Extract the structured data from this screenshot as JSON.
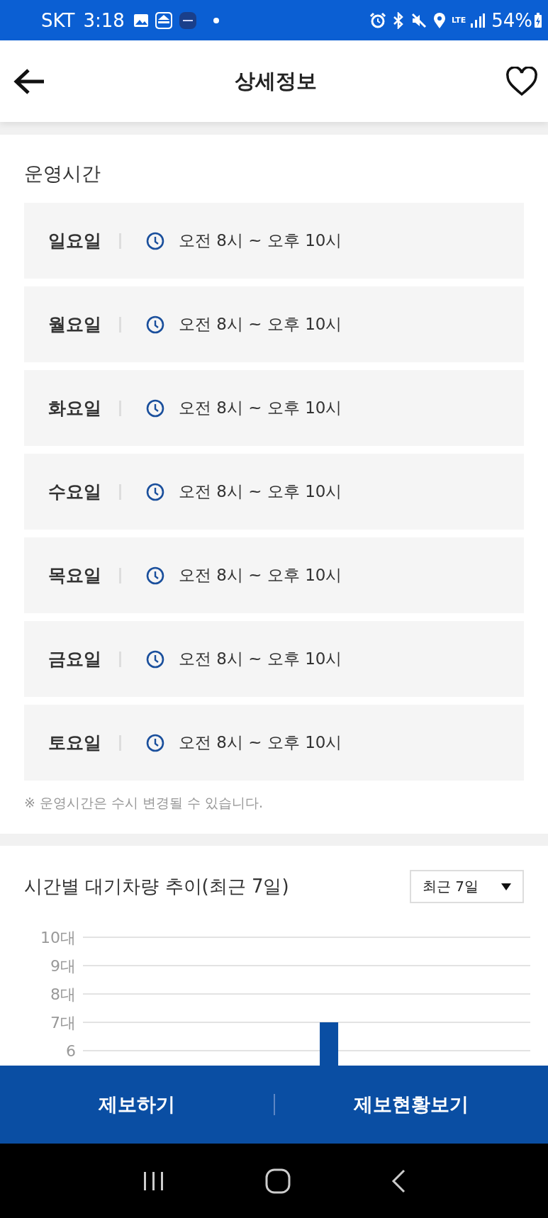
{
  "status_bar": {
    "carrier": "SKT",
    "time": "3:18",
    "network": "LTE",
    "battery": "54%"
  },
  "header": {
    "title": "상세정보",
    "favorite": false
  },
  "hours": {
    "title": "운영시간",
    "days": [
      {
        "day": "일요일",
        "time": "오전 8시 ~ 오후 10시"
      },
      {
        "day": "월요일",
        "time": "오전 8시 ~ 오후 10시"
      },
      {
        "day": "화요일",
        "time": "오전 8시 ~ 오후 10시"
      },
      {
        "day": "수요일",
        "time": "오전 8시 ~ 오후 10시"
      },
      {
        "day": "목요일",
        "time": "오전 8시 ~ 오후 10시"
      },
      {
        "day": "금요일",
        "time": "오전 8시 ~ 오후 10시"
      },
      {
        "day": "토요일",
        "time": "오전 8시 ~ 오후 10시"
      }
    ],
    "note": "※ 운영시간은 수시 변경될 수 있습니다."
  },
  "wait_chart": {
    "title": "시간별 대기차량 추이(최근 7일)",
    "period_select": {
      "value": "최근 7일"
    },
    "chart_data": {
      "type": "bar",
      "ylim": [
        0,
        10
      ],
      "grid": true,
      "yticks": [
        {
          "value": 6,
          "label": "6"
        },
        {
          "value": 7,
          "label": "7대"
        },
        {
          "value": 8,
          "label": "8대"
        },
        {
          "value": 9,
          "label": "9대"
        },
        {
          "value": 10,
          "label": "10대"
        }
      ],
      "values": [
        null,
        null,
        null,
        null,
        null,
        7,
        null,
        null,
        null,
        null
      ]
    }
  },
  "bottom_bar": {
    "buttons": [
      "제보하기",
      "제보현황보기"
    ]
  }
}
